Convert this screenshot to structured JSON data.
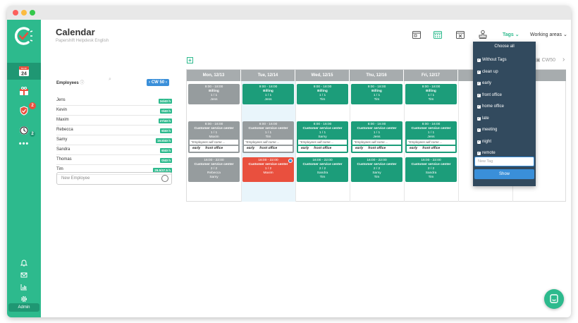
{
  "header": {
    "title": "Calendar",
    "subtitle": "Papershift Helpdesk English"
  },
  "colors": {
    "brand": "#2dba8d",
    "shift_green": "#1c9d7a",
    "shift_gray": "#969c9e",
    "shift_red": "#e9503e",
    "dropdown_bg": "#324a5e",
    "accent_blue": "#3a8fd9"
  },
  "sidebar": {
    "calendar_month": "Month",
    "calendar_day": "24",
    "badges": {
      "vacation": "2",
      "timetracking": "2"
    },
    "more": "•••",
    "admin_label": "Admin",
    "icons": [
      "calendar-icon",
      "gift-icon",
      "shield-icon",
      "clock-icon",
      "bell-icon",
      "mail-icon",
      "chart-icon",
      "gear-icon"
    ]
  },
  "toolbar": {
    "tags_label": "Tags",
    "working_areas_label": "Working areas"
  },
  "calendar": {
    "cw_label": "CW50",
    "cw_badge": "‹ CW 50 ›",
    "days": [
      "Mon, 12/13",
      "Tue, 12/14",
      "Wed, 12/15",
      "Thu, 12/16",
      "Fri, 12/17",
      "",
      ""
    ]
  },
  "employees": {
    "header": "Employees",
    "list": [
      {
        "name": "Jens",
        "hours": "34/40 h"
      },
      {
        "name": "Kevin",
        "hours": "0/40 h"
      },
      {
        "name": "Maxim",
        "hours": "27/40 h"
      },
      {
        "name": "Rebecca",
        "hours": "6/40 h"
      },
      {
        "name": "Samy",
        "hours": "19.5/40 h"
      },
      {
        "name": "Sandra",
        "hours": "6/40 h"
      },
      {
        "name": "Thomas",
        "hours": "0/40 h"
      },
      {
        "name": "Tim",
        "hours": "29.5/37.5 h"
      }
    ],
    "new_placeholder": "New Employee"
  },
  "shifts": {
    "billing": [
      {
        "time": "9:00 - 18:00",
        "area": "Billing",
        "count": "1 / 1",
        "people": "Jens"
      },
      {
        "time": "9:00 - 18:00",
        "area": "Billing",
        "count": "1 / 1",
        "people": "Jens"
      },
      {
        "time": "9:00 - 18:00",
        "area": "Billing",
        "count": "1 / 1",
        "people": "Tim"
      },
      {
        "time": "9:00 - 18:00",
        "area": "Billing",
        "count": "1 / 1",
        "people": "Tim"
      },
      {
        "time": "9:00 - 18:00",
        "area": "Billing",
        "count": "1 / 1",
        "people": "Tim"
      }
    ],
    "morning": [
      {
        "time": "8:00 - 16:00",
        "area": "Customer service center",
        "count": "1 / 1",
        "people": "Maxim",
        "note": "\"Employees will come ...",
        "tags": [
          "early",
          "front office"
        ]
      },
      {
        "time": "8:00 - 16:00",
        "area": "Customer service center",
        "count": "1 / 1",
        "people": "Tim",
        "note": "\"Employees will come ...",
        "tags": [
          "early",
          "front office"
        ]
      },
      {
        "time": "8:00 - 16:00",
        "area": "Customer service center",
        "count": "1 / 1",
        "people": "Samy",
        "note": "\"Employees will come ...",
        "tags": [
          "early",
          "front office"
        ]
      },
      {
        "time": "8:00 - 16:00",
        "area": "Customer service center",
        "count": "1 / 1",
        "people": "Jens",
        "note": "\"Employees will come ...",
        "tags": [
          "early",
          "front office"
        ]
      },
      {
        "time": "8:00 - 16:00",
        "area": "Customer service center",
        "count": "1 / 1",
        "people": "Jens",
        "note": "\"Employees will come ...",
        "tags": [
          "early",
          "front office"
        ]
      }
    ],
    "evening": [
      {
        "time": "16:00 - 22:00",
        "area": "Customer service center",
        "count": "2 / 2",
        "people1": "Rebecca",
        "people2": "Samy"
      },
      {
        "time": "16:00 - 22:00",
        "area": "Customer service center",
        "count": "1 / 2",
        "people1": "Maxim",
        "people2": ""
      },
      {
        "time": "16:00 - 22:00",
        "area": "Customer service center",
        "count": "2 / 2",
        "people1": "Sandra",
        "people2": "Tim"
      },
      {
        "time": "16:00 - 22:00",
        "area": "Customer service center",
        "count": "2 / 2",
        "people1": "Samy",
        "people2": "Tim"
      },
      {
        "time": "16:00 - 22:00",
        "area": "Customer service center",
        "count": "2 / 2",
        "people1": "Sandra",
        "people2": "Tim"
      }
    ]
  },
  "tags_dropdown": {
    "choose_all": "Choose all",
    "items": [
      "Without Tags",
      "clean up",
      "early",
      "front office",
      "home office",
      "late",
      "meeting",
      "night",
      "remote"
    ],
    "new_tag_placeholder": "New Tag",
    "show_label": "Show"
  }
}
